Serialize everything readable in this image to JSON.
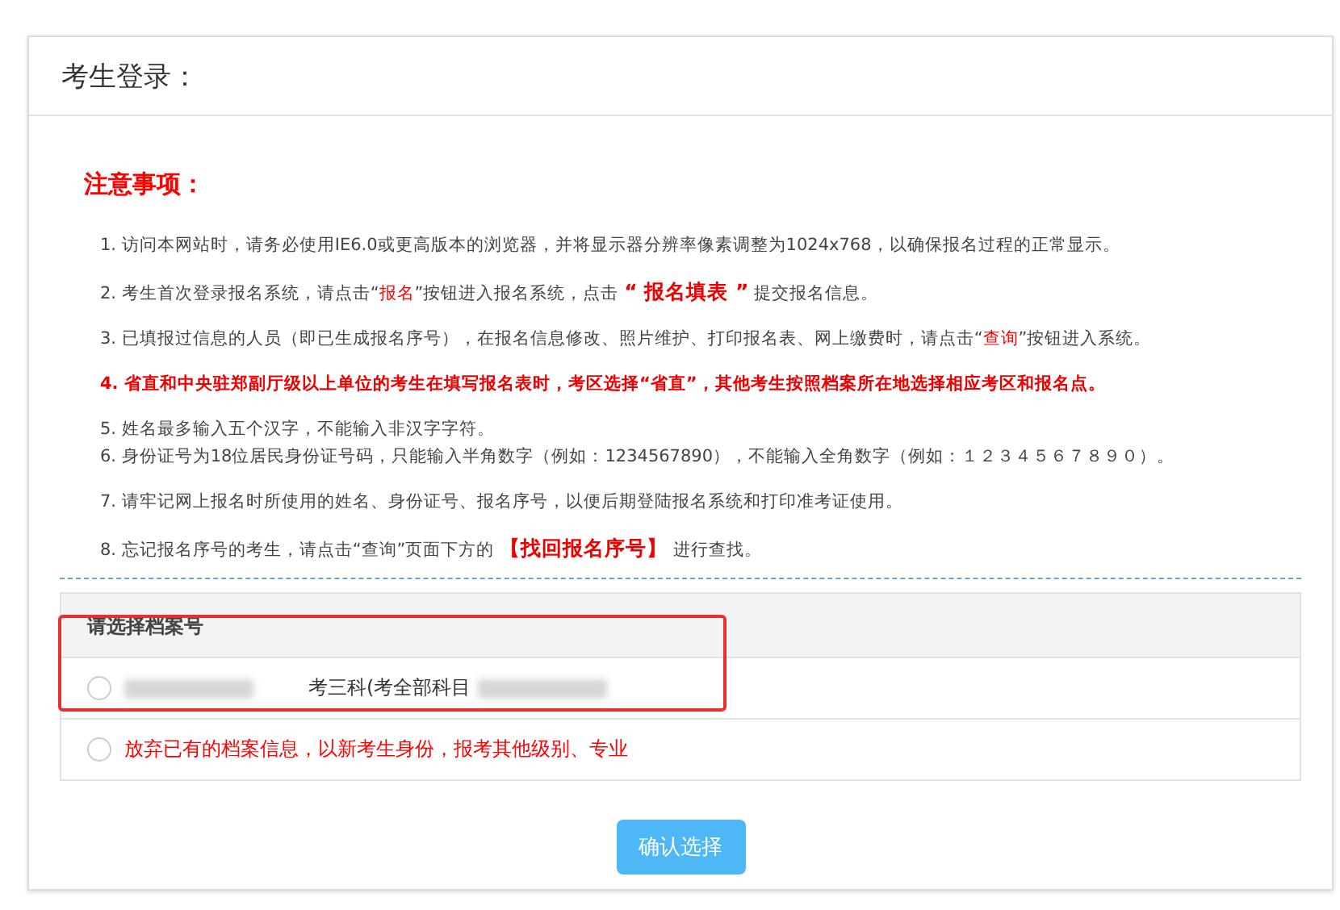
{
  "panel": {
    "title": "考生登录："
  },
  "notice": {
    "title": "注意事项：",
    "items": [
      {
        "kind": "normal",
        "text": "1. 访问本网站时，请务必使用IE6.0或更高版本的浏览器，并将显示器分辨率像素调整为1024x768，以确保报名过程的正常显示。"
      },
      {
        "kind": "normal",
        "text": "2. 考生首次登录报名系统，请点击“*报名*”按钮进入报名系统，点击 **“ 报名填表 ”** 提交报名信息。"
      },
      {
        "kind": "normal",
        "text": "3. 已填报过信息的人员（即已生成报名序号），在报名信息修改、照片维护、打印报名表、网上缴费时，请点击“*查询*”按钮进入系统。"
      },
      {
        "kind": "warning",
        "text": "**4. 省直和中央驻郑副厅级以上单位的考生在填写报名表时，考区选择“省直”，其他考生按照档案所在地选择相应考区和报名点。**"
      },
      {
        "kind": "tight",
        "text": "5. 姓名最多输入五个汉字，不能输入非汉字字符。"
      },
      {
        "kind": "normal",
        "text": "6. 身份证号为18位居民身份证号码，只能输入半角数字（例如：1234567890），不能输入全角数字（例如：１２３４５６７８９０）。"
      },
      {
        "kind": "normal",
        "text": "7. 请牢记网上报名时所使用的姓名、身份证号、报名序号，以便后期登陆报名系统和打印准考证使用。"
      },
      {
        "kind": "normal",
        "text": "8. 忘记报名序号的考生，请点击“查询”页面下方的 **【找回报名序号】** 进行查找。"
      }
    ]
  },
  "records": {
    "header": "请选择档案号",
    "options": [
      {
        "kind": "record",
        "selected": false,
        "label": "考三科(考全部科目"
      },
      {
        "kind": "abandon",
        "selected": false,
        "label": "放弃已有的档案信息，以新考生身份，报考其他级别、专业"
      }
    ]
  },
  "confirm_button": "确认选择"
}
